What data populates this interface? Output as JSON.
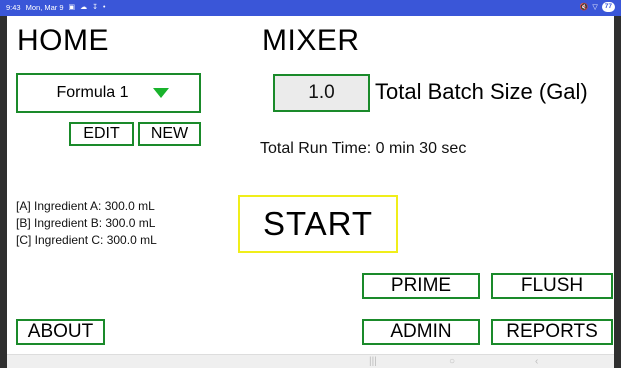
{
  "status_bar": {
    "time": "9:43",
    "date": "Mon, Mar 9",
    "battery": "77",
    "accent_color": "#3a56d8"
  },
  "home": {
    "title": "HOME"
  },
  "mixer": {
    "title": "MIXER"
  },
  "formula_select": {
    "selected": "Formula 1"
  },
  "buttons": {
    "edit": "EDIT",
    "new": "NEW",
    "prime": "PRIME",
    "flush": "FLUSH",
    "about": "ABOUT",
    "admin": "ADMIN",
    "reports": "REPORTS",
    "start": "START"
  },
  "batch": {
    "value": "1.0",
    "label": "Total Batch Size (Gal)"
  },
  "run_time": "Total Run Time: 0 min 30 sec",
  "ingredients": [
    "[A] Ingredient A: 300.0 mL",
    "[B] Ingredient B: 300.0 mL",
    "[C] Ingredient C: 300.0 mL"
  ],
  "colors": {
    "button_border": "#1a8a2a",
    "start_border": "#f0ee1a",
    "dropdown_arrow": "#19b32c"
  }
}
